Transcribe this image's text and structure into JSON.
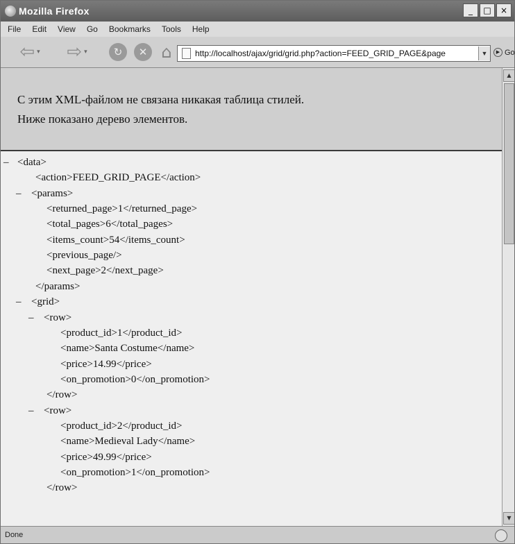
{
  "window": {
    "title": "Mozilla Firefox",
    "buttons": {
      "minimize": "_",
      "maximize": "□",
      "close": "×"
    }
  },
  "menu": [
    "File",
    "Edit",
    "View",
    "Go",
    "Bookmarks",
    "Tools",
    "Help"
  ],
  "toolbar": {
    "icons": {
      "back": "back-arrow-icon",
      "forward": "forward-arrow-icon",
      "reload": "reload-icon",
      "stop": "stop-icon",
      "home": "home-icon"
    },
    "url": "http://localhost/ajax/grid/grid.php?action=FEED_GRID_PAGE&page",
    "go_label": "Go"
  },
  "notice": {
    "line1": "С этим XML-файлом не связана никакая таблица стилей.",
    "line2": "Ниже показано дерево элементов."
  },
  "xml": {
    "lines": [
      {
        "toggle": "–",
        "text": "<data>"
      },
      {
        "toggle": "",
        "text": "<action>FEED_GRID_PAGE</action>"
      },
      {
        "toggle": "–",
        "text": "<params>"
      },
      {
        "toggle": "",
        "text": "<returned_page>1</returned_page>"
      },
      {
        "toggle": "",
        "text": "<total_pages>6</total_pages>"
      },
      {
        "toggle": "",
        "text": "<items_count>54</items_count>"
      },
      {
        "toggle": "",
        "text": "<previous_page/>"
      },
      {
        "toggle": "",
        "text": "<next_page>2</next_page>"
      },
      {
        "toggle": "",
        "text": "</params>"
      },
      {
        "toggle": "–",
        "text": "<grid>"
      },
      {
        "toggle": "–",
        "text": "<row>"
      },
      {
        "toggle": "",
        "text": "<product_id>1</product_id>"
      },
      {
        "toggle": "",
        "text": "<name>Santa Costume</name>"
      },
      {
        "toggle": "",
        "text": "<price>14.99</price>"
      },
      {
        "toggle": "",
        "text": "<on_promotion>0</on_promotion>"
      },
      {
        "toggle": "",
        "text": "</row>"
      },
      {
        "toggle": "–",
        "text": "<row>"
      },
      {
        "toggle": "",
        "text": "<product_id>2</product_id>"
      },
      {
        "toggle": "",
        "text": "<name>Medieval Lady</name>"
      },
      {
        "toggle": "",
        "text": "<price>49.99</price>"
      },
      {
        "toggle": "",
        "text": "<on_promotion>1</on_promotion>"
      },
      {
        "toggle": "",
        "text": "</row>"
      }
    ]
  },
  "status": {
    "text": "Done"
  }
}
